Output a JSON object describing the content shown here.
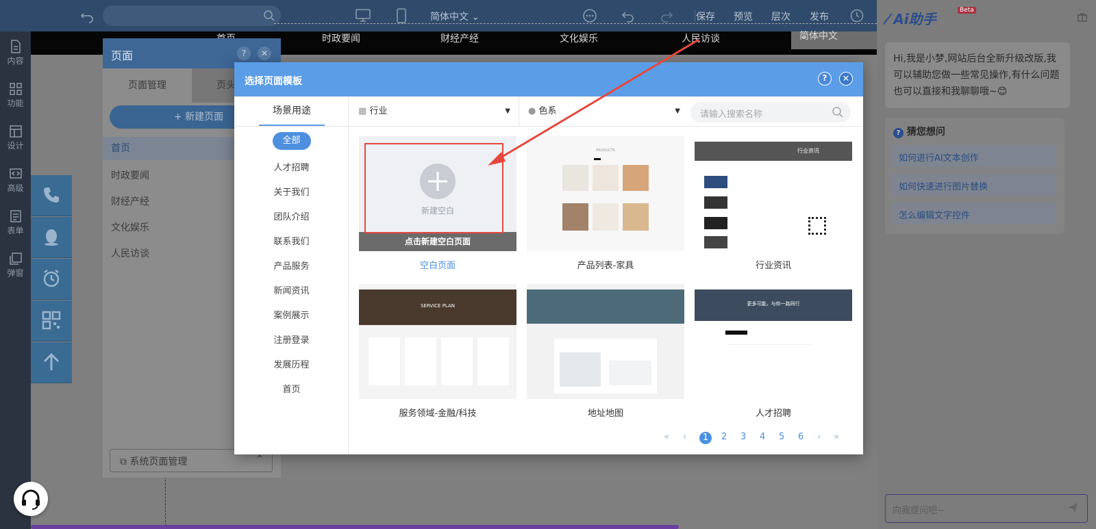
{
  "topbar": {
    "lang": "简体中文",
    "save": "保存",
    "preview": "预览",
    "layers": "层次",
    "publish": "发布"
  },
  "rail": [
    {
      "label": "内容",
      "icon": "file-icon"
    },
    {
      "label": "功能",
      "icon": "grid-icon"
    },
    {
      "label": "设计",
      "icon": "layout-icon"
    },
    {
      "label": "高级",
      "icon": "code-icon"
    },
    {
      "label": "表单",
      "icon": "form-icon"
    },
    {
      "label": "弹窗",
      "icon": "popup-icon"
    }
  ],
  "site_nav": {
    "items": [
      "首页",
      "时政要闻",
      "财经产经",
      "文化娱乐",
      "人民访谈"
    ],
    "lang": "简体中文"
  },
  "page_panel": {
    "title": "页面",
    "tab_manage": "页面管理",
    "tab_other": "页头",
    "new_page": "+ 新建页面",
    "pages": [
      "首页",
      "时政要闻",
      "财经产经",
      "文化娱乐",
      "人民访谈"
    ],
    "system_pages": "系统页面管理"
  },
  "modal": {
    "title": "选择页面模板",
    "scene_tab": "场景用途",
    "categories": [
      "全部",
      "人才招聘",
      "关于我们",
      "团队介绍",
      "联系我们",
      "产品服务",
      "新闻资讯",
      "案例展示",
      "注册登录",
      "发展历程",
      "首页"
    ],
    "industry": "行业",
    "color": "色系",
    "search_placeholder": "请输入搜索名称",
    "blank_text": "新建空白",
    "blank_hint": "点击新建空白页面",
    "templates": [
      {
        "name": "空白页面"
      },
      {
        "name": "产品列表-家具"
      },
      {
        "name": "行业资讯"
      },
      {
        "name": "服务领域-金融/科技"
      },
      {
        "name": "地址地图"
      },
      {
        "name": "人才招聘"
      }
    ],
    "thumb_texts": {
      "products": "PRODUCTS",
      "industry_news": "行业资讯",
      "service_plan": "SERVICE PLAN",
      "talent_banner": "更多可能，与你一路同行"
    },
    "pages": [
      "1",
      "2",
      "3",
      "4",
      "5",
      "6"
    ],
    "current_page": "1"
  },
  "ai": {
    "logo": "Ai助手",
    "beta": "Beta",
    "greeting": "Hi,我是小梦,网站后台全新升级改版,我可以辅助您做一些常见操作,有什么问题也可以直接和我聊聊哦~😊",
    "guess_title": "猜您想问",
    "questions": [
      "如何进行AI文本创作",
      "如何快速进行图片替换",
      "怎么编辑文字控件"
    ],
    "ask_placeholder": "向我提问吧~"
  },
  "colors": {
    "modal_header": "#5b9de6",
    "accent": "#4a90e2",
    "highlight_red": "#e5483e"
  }
}
